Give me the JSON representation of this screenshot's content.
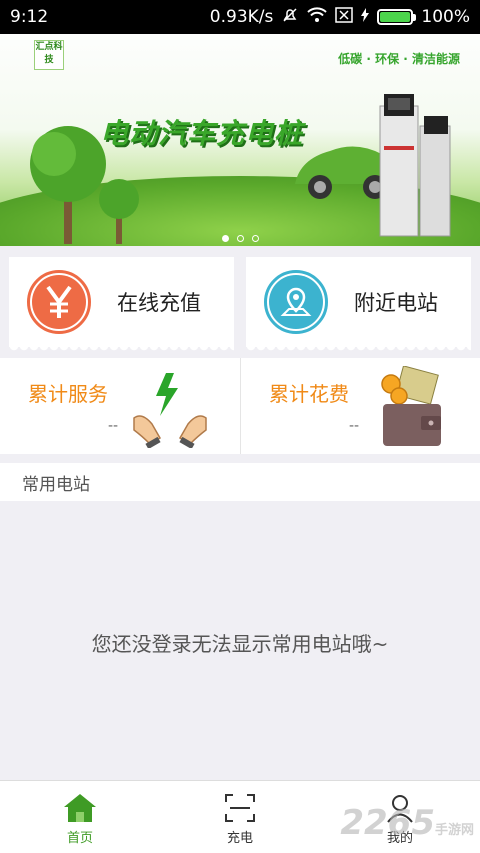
{
  "status_bar": {
    "time": "9:12",
    "speed": "0.93K/s",
    "battery": "100%"
  },
  "banner": {
    "logo_text": "汇点科技",
    "slogan": "低碳 · 环保 · 清洁能源",
    "title": "电动汽车充电桩",
    "fine_print": "",
    "slide_count": 3,
    "active_slide": 1
  },
  "actions": [
    {
      "label": "在线充值",
      "color": "#ee6b45",
      "icon": "yuan-icon"
    },
    {
      "label": "附近电站",
      "color": "#3cb3cf",
      "icon": "map-pin-icon"
    }
  ],
  "stats": [
    {
      "title": "累计服务",
      "value": "--",
      "icon": "hands-lightning-icon"
    },
    {
      "title": "累计花费",
      "value": "--",
      "icon": "wallet-icon"
    }
  ],
  "section": {
    "title": "常用电站"
  },
  "empty_message": "您还没登录无法显示常用电站哦~",
  "nav": [
    {
      "label": "首页",
      "icon": "home-icon",
      "active": true
    },
    {
      "label": "充电",
      "icon": "scan-icon",
      "active": false
    },
    {
      "label": "我的",
      "icon": "user-icon",
      "active": false
    }
  ],
  "watermark": {
    "main": "2265",
    "sub": "手游网"
  },
  "colors": {
    "accent_green": "#3f9b25",
    "orange": "#f08a17"
  }
}
